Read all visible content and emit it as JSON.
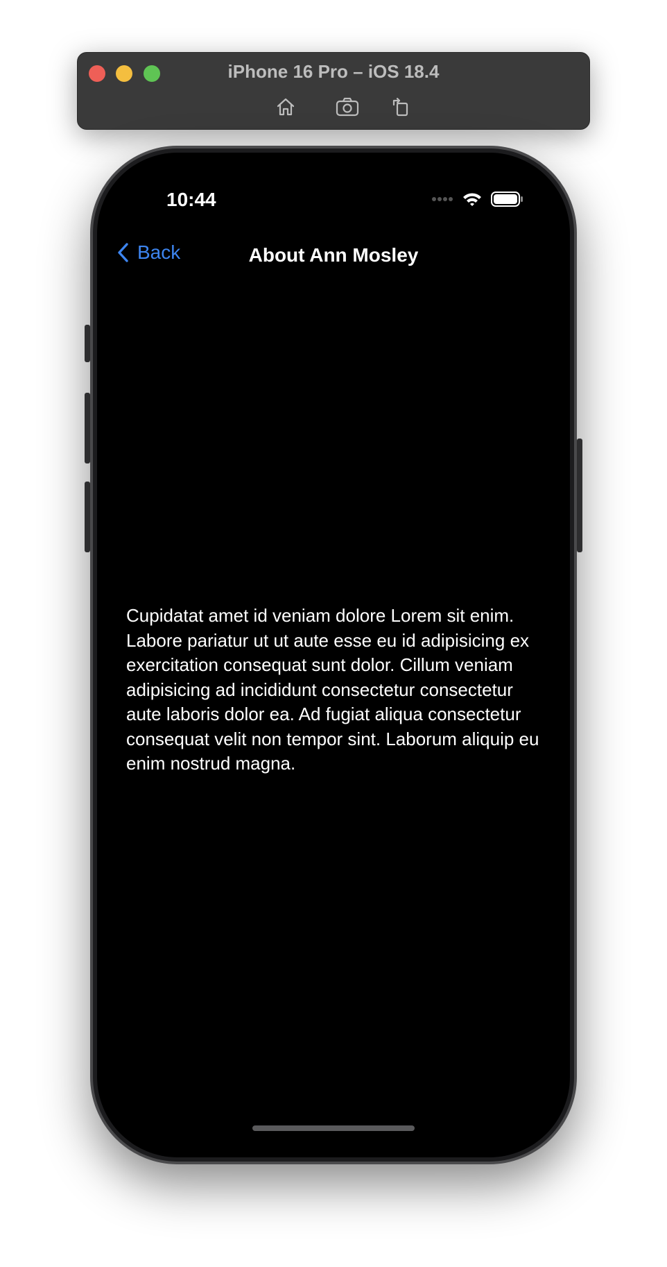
{
  "window": {
    "title": "iPhone 16 Pro – iOS 18.4",
    "toolbar": {
      "home_icon": "home-icon",
      "screenshot_icon": "camera-icon",
      "rotate_icon": "rotate-icon"
    }
  },
  "status_bar": {
    "time": "10:44"
  },
  "nav": {
    "back_label": "Back",
    "title": "About Ann Mosley"
  },
  "content": {
    "body": "Cupidatat amet id veniam dolore Lorem sit enim. Labore pariatur ut ut aute esse eu id adipisicing ex exercitation consequat sunt dolor. Cillum veniam adipisicing ad incididunt consectetur consectetur aute laboris dolor ea. Ad fugiat aliqua consectetur consequat velit non tempor sint. Laborum aliquip eu enim nostrud magna."
  },
  "colors": {
    "accent": "#3d85f0",
    "screen_background": "#000000",
    "window_chrome": "#3a3a3a"
  }
}
